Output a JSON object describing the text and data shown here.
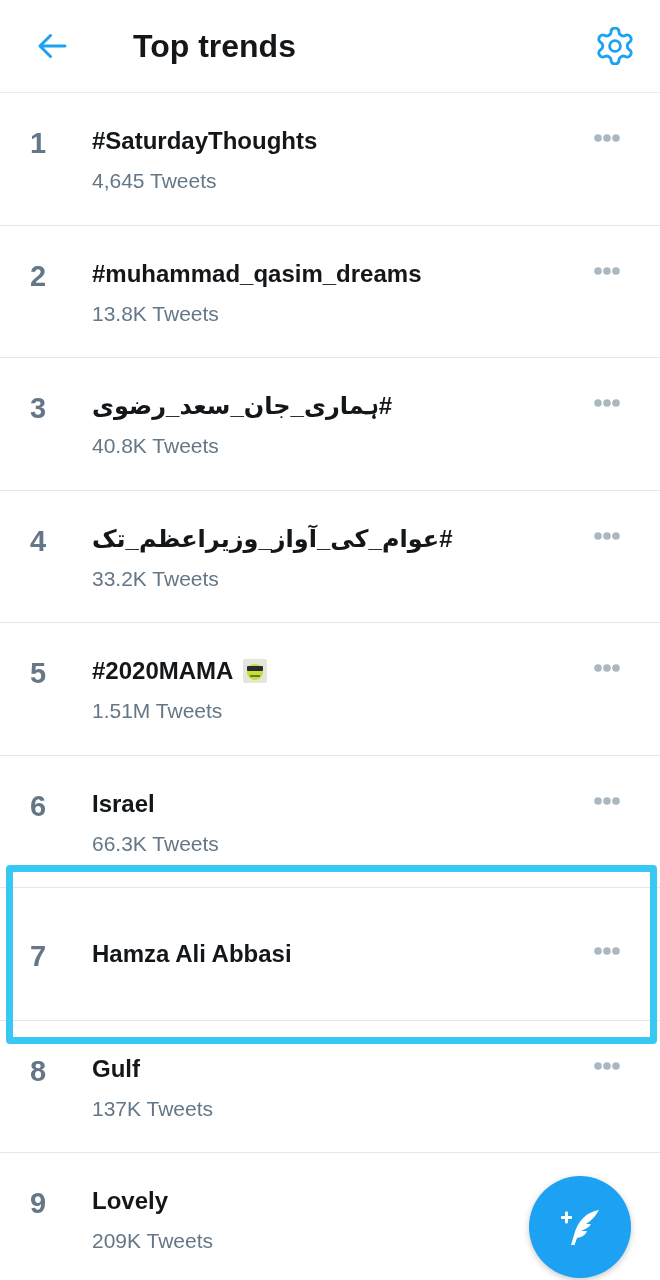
{
  "header": {
    "title": "Top trends"
  },
  "trends": [
    {
      "rank": "1",
      "name": "#SaturdayThoughts",
      "tweets": "4,645 Tweets",
      "hashflag": false,
      "highlighted": false
    },
    {
      "rank": "2",
      "name": "#muhammad_qasim_dreams",
      "tweets": "13.8K Tweets",
      "hashflag": false,
      "highlighted": false
    },
    {
      "rank": "3",
      "name": "#ہماری_جان_سعد_رضوی",
      "tweets": "40.8K Tweets",
      "hashflag": false,
      "highlighted": false
    },
    {
      "rank": "4",
      "name": "#عوام_کی_آواز_وزیراعظم_تک",
      "tweets": "33.2K Tweets",
      "hashflag": false,
      "highlighted": false
    },
    {
      "rank": "5",
      "name": "#2020MAMA",
      "tweets": "1.51M Tweets",
      "hashflag": true,
      "highlighted": false
    },
    {
      "rank": "6",
      "name": "Israel",
      "tweets": "66.3K Tweets",
      "hashflag": false,
      "highlighted": false
    },
    {
      "rank": "7",
      "name": "Hamza Ali Abbasi",
      "hashflag": false,
      "highlighted": true
    },
    {
      "rank": "8",
      "name": "Gulf",
      "tweets": "137K Tweets",
      "hashflag": false,
      "highlighted": false
    },
    {
      "rank": "9",
      "name": "Lovely",
      "tweets": "209K Tweets",
      "hashflag": false,
      "highlighted": false
    }
  ]
}
